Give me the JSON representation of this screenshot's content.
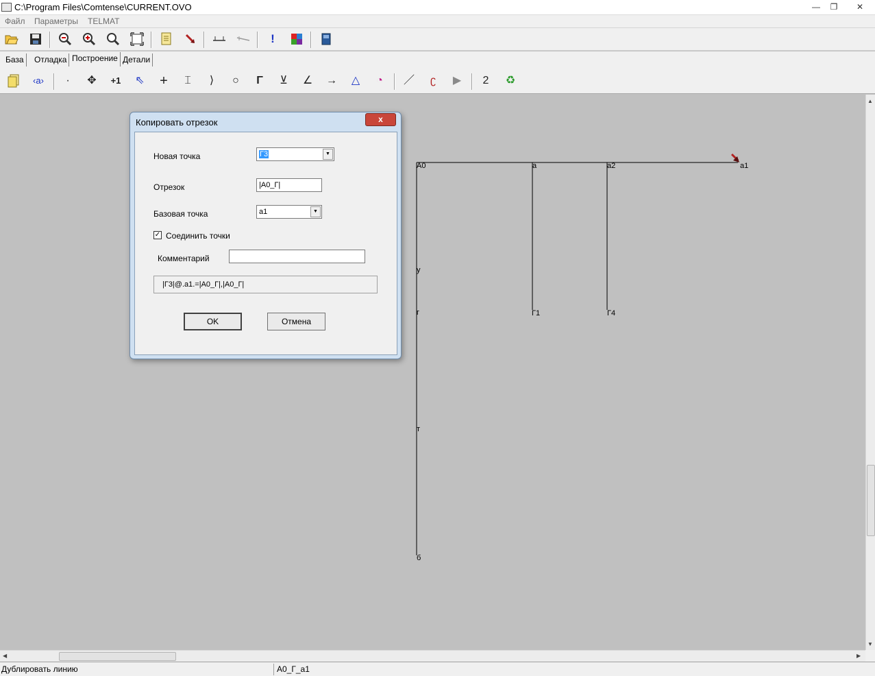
{
  "window": {
    "title": "C:\\Program Files\\Comtense\\CURRENT.OVO",
    "min_glyph": "—",
    "max_glyph": "❐",
    "close_glyph": "✕"
  },
  "menu": [
    "Файл",
    "Параметры",
    "TELMAT"
  ],
  "tabs": [
    "База",
    "Отладка",
    "Построение",
    "Детали"
  ],
  "active_tab": "Построение",
  "toolbar2": {
    "number_label": "2"
  },
  "canvas": {
    "points": [
      "A0",
      "a",
      "a2",
      "a1",
      "у",
      "г",
      "Г1",
      "Г4",
      "т",
      "б"
    ]
  },
  "dialog": {
    "title": "Копировать отрезок",
    "close_label": "x",
    "new_point_label": "Новая точка",
    "new_point_value": "Г3",
    "segment_label": "Отрезок",
    "segment_value": "|A0_Г|",
    "base_point_label": "Базовая точка",
    "base_point_value": "a1",
    "connect_label": "Соединить точки",
    "connect_checked": true,
    "comment_label": "Комментарий",
    "comment_value": "",
    "formula": "|Г3|@.a1.=|A0_Г|,|A0_Г|",
    "ok_label": "OK",
    "cancel_label": "Отмена"
  },
  "status": {
    "left": "Дублировать линию",
    "right": "A0_Г_a1"
  },
  "colors": {
    "canvas_bg": "#c0c0c0",
    "dialog_frame": "#cfe0f1",
    "close_red": "#c9463a",
    "marker_red": "#b22222"
  }
}
